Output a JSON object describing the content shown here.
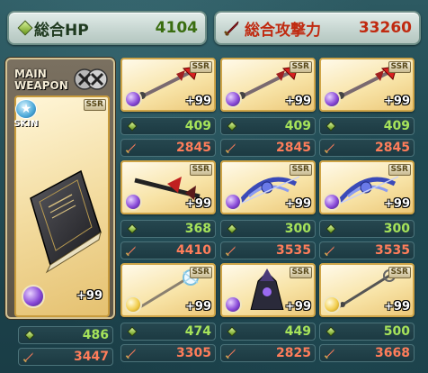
{
  "header": {
    "hp_label": "総合HP",
    "hp_value": "4104",
    "atk_label": "総合攻撃力",
    "atk_value": "33260"
  },
  "main_weapon": {
    "title_line1": "MAIN",
    "title_line2": "WEAPON",
    "skin_label": "SKIN",
    "rarity": "SSR",
    "level": "+99",
    "element": "dark",
    "hp": "486",
    "atk": "3447"
  },
  "grid": [
    {
      "rarity": "SSR",
      "level": "+99",
      "element": "dark",
      "art": "red-spear",
      "hp": "409",
      "atk": "2845"
    },
    {
      "rarity": "SSR",
      "level": "+99",
      "element": "dark",
      "art": "red-spear",
      "hp": "409",
      "atk": "2845"
    },
    {
      "rarity": "SSR",
      "level": "+99",
      "element": "dark",
      "art": "red-spear",
      "hp": "409",
      "atk": "2845"
    },
    {
      "rarity": "SSR",
      "level": "+99",
      "element": "dark",
      "art": "dark-blade",
      "hp": "368",
      "atk": "4410"
    },
    {
      "rarity": "SSR",
      "level": "+99",
      "element": "dark",
      "art": "blue-bow",
      "hp": "300",
      "atk": "3535"
    },
    {
      "rarity": "SSR",
      "level": "+99",
      "element": "dark",
      "art": "blue-bow",
      "hp": "300",
      "atk": "3535"
    },
    {
      "rarity": "SSR",
      "level": "+99",
      "element": "light",
      "art": "white-staff",
      "hp": "474",
      "atk": "3305"
    },
    {
      "rarity": "SSR",
      "level": "+99",
      "element": "dark",
      "art": "dark-gauntlet",
      "hp": "449",
      "atk": "2825"
    },
    {
      "rarity": "SSR",
      "level": "+99",
      "element": "light",
      "art": "silver-staff",
      "hp": "500",
      "atk": "3668"
    }
  ],
  "colors": {
    "hp_text": "#3a6d10",
    "atk_text": "#c02a10",
    "card_border": "#cfa548"
  }
}
